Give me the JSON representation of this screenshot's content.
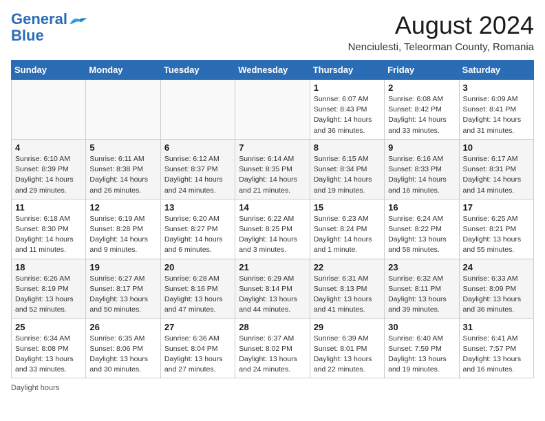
{
  "header": {
    "logo_line1": "General",
    "logo_line2": "Blue",
    "month_year": "August 2024",
    "location": "Nenciulesti, Teleorman County, Romania"
  },
  "weekdays": [
    "Sunday",
    "Monday",
    "Tuesday",
    "Wednesday",
    "Thursday",
    "Friday",
    "Saturday"
  ],
  "weeks": [
    [
      {
        "day": "",
        "info": ""
      },
      {
        "day": "",
        "info": ""
      },
      {
        "day": "",
        "info": ""
      },
      {
        "day": "",
        "info": ""
      },
      {
        "day": "1",
        "info": "Sunrise: 6:07 AM\nSunset: 8:43 PM\nDaylight: 14 hours\nand 36 minutes."
      },
      {
        "day": "2",
        "info": "Sunrise: 6:08 AM\nSunset: 8:42 PM\nDaylight: 14 hours\nand 33 minutes."
      },
      {
        "day": "3",
        "info": "Sunrise: 6:09 AM\nSunset: 8:41 PM\nDaylight: 14 hours\nand 31 minutes."
      }
    ],
    [
      {
        "day": "4",
        "info": "Sunrise: 6:10 AM\nSunset: 8:39 PM\nDaylight: 14 hours\nand 29 minutes."
      },
      {
        "day": "5",
        "info": "Sunrise: 6:11 AM\nSunset: 8:38 PM\nDaylight: 14 hours\nand 26 minutes."
      },
      {
        "day": "6",
        "info": "Sunrise: 6:12 AM\nSunset: 8:37 PM\nDaylight: 14 hours\nand 24 minutes."
      },
      {
        "day": "7",
        "info": "Sunrise: 6:14 AM\nSunset: 8:35 PM\nDaylight: 14 hours\nand 21 minutes."
      },
      {
        "day": "8",
        "info": "Sunrise: 6:15 AM\nSunset: 8:34 PM\nDaylight: 14 hours\nand 19 minutes."
      },
      {
        "day": "9",
        "info": "Sunrise: 6:16 AM\nSunset: 8:33 PM\nDaylight: 14 hours\nand 16 minutes."
      },
      {
        "day": "10",
        "info": "Sunrise: 6:17 AM\nSunset: 8:31 PM\nDaylight: 14 hours\nand 14 minutes."
      }
    ],
    [
      {
        "day": "11",
        "info": "Sunrise: 6:18 AM\nSunset: 8:30 PM\nDaylight: 14 hours\nand 11 minutes."
      },
      {
        "day": "12",
        "info": "Sunrise: 6:19 AM\nSunset: 8:28 PM\nDaylight: 14 hours\nand 9 minutes."
      },
      {
        "day": "13",
        "info": "Sunrise: 6:20 AM\nSunset: 8:27 PM\nDaylight: 14 hours\nand 6 minutes."
      },
      {
        "day": "14",
        "info": "Sunrise: 6:22 AM\nSunset: 8:25 PM\nDaylight: 14 hours\nand 3 minutes."
      },
      {
        "day": "15",
        "info": "Sunrise: 6:23 AM\nSunset: 8:24 PM\nDaylight: 14 hours\nand 1 minute."
      },
      {
        "day": "16",
        "info": "Sunrise: 6:24 AM\nSunset: 8:22 PM\nDaylight: 13 hours\nand 58 minutes."
      },
      {
        "day": "17",
        "info": "Sunrise: 6:25 AM\nSunset: 8:21 PM\nDaylight: 13 hours\nand 55 minutes."
      }
    ],
    [
      {
        "day": "18",
        "info": "Sunrise: 6:26 AM\nSunset: 8:19 PM\nDaylight: 13 hours\nand 52 minutes."
      },
      {
        "day": "19",
        "info": "Sunrise: 6:27 AM\nSunset: 8:17 PM\nDaylight: 13 hours\nand 50 minutes."
      },
      {
        "day": "20",
        "info": "Sunrise: 6:28 AM\nSunset: 8:16 PM\nDaylight: 13 hours\nand 47 minutes."
      },
      {
        "day": "21",
        "info": "Sunrise: 6:29 AM\nSunset: 8:14 PM\nDaylight: 13 hours\nand 44 minutes."
      },
      {
        "day": "22",
        "info": "Sunrise: 6:31 AM\nSunset: 8:13 PM\nDaylight: 13 hours\nand 41 minutes."
      },
      {
        "day": "23",
        "info": "Sunrise: 6:32 AM\nSunset: 8:11 PM\nDaylight: 13 hours\nand 39 minutes."
      },
      {
        "day": "24",
        "info": "Sunrise: 6:33 AM\nSunset: 8:09 PM\nDaylight: 13 hours\nand 36 minutes."
      }
    ],
    [
      {
        "day": "25",
        "info": "Sunrise: 6:34 AM\nSunset: 8:08 PM\nDaylight: 13 hours\nand 33 minutes."
      },
      {
        "day": "26",
        "info": "Sunrise: 6:35 AM\nSunset: 8:06 PM\nDaylight: 13 hours\nand 30 minutes."
      },
      {
        "day": "27",
        "info": "Sunrise: 6:36 AM\nSunset: 8:04 PM\nDaylight: 13 hours\nand 27 minutes."
      },
      {
        "day": "28",
        "info": "Sunrise: 6:37 AM\nSunset: 8:02 PM\nDaylight: 13 hours\nand 24 minutes."
      },
      {
        "day": "29",
        "info": "Sunrise: 6:39 AM\nSunset: 8:01 PM\nDaylight: 13 hours\nand 22 minutes."
      },
      {
        "day": "30",
        "info": "Sunrise: 6:40 AM\nSunset: 7:59 PM\nDaylight: 13 hours\nand 19 minutes."
      },
      {
        "day": "31",
        "info": "Sunrise: 6:41 AM\nSunset: 7:57 PM\nDaylight: 13 hours\nand 16 minutes."
      }
    ]
  ],
  "footer": {
    "note": "Daylight hours"
  }
}
